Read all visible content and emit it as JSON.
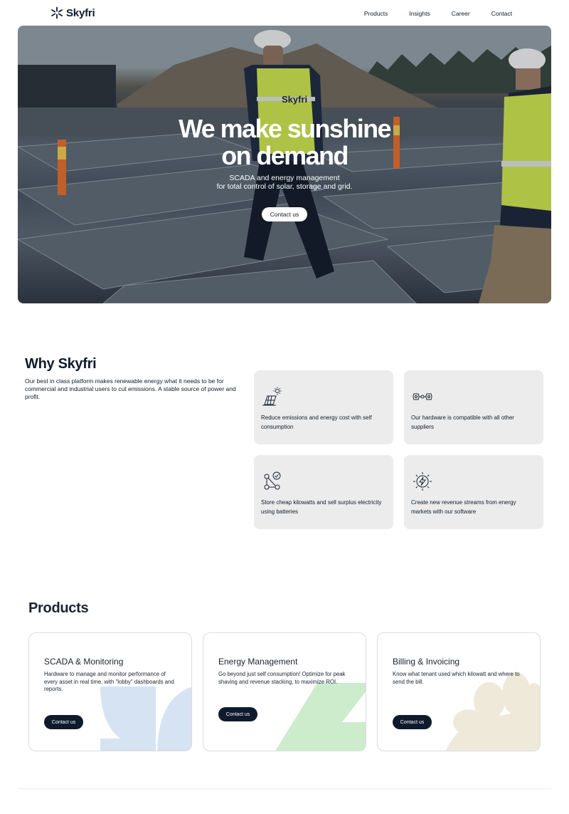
{
  "nav": {
    "brand": "Skyfri",
    "links": [
      "Products",
      "Insights",
      "Career",
      "Contact"
    ]
  },
  "hero": {
    "title_line1": "We make sunshine",
    "title_line2": "on demand",
    "subtitle_line1": "SCADA and energy management",
    "subtitle_line2": "for total control of solar, storage and grid.",
    "cta": "Contact us",
    "vest_logo": "Skyfri"
  },
  "why": {
    "title": "Why Skyfri",
    "description": "Our best in class platform makes renewable energy what it needs to be for commercial and industrial users to cut emissions. A stable source of power and profit.",
    "features": [
      {
        "icon": "solar-panel-icon",
        "text": "Reduce emissions and energy cost with self consumption"
      },
      {
        "icon": "hardware-link-icon",
        "text": "Our hardware is compatible with all other suppliers"
      },
      {
        "icon": "battery-network-icon",
        "text": "Store cheap kilowatts and sell surplus electricity using batteries"
      },
      {
        "icon": "lightning-sun-icon",
        "text": "Create new revenue streams from energy markets with our software"
      }
    ]
  },
  "products": {
    "title": "Products",
    "cards": [
      {
        "title": "SCADA & Monitoring",
        "description": "Hardware to manage and monitor performance of every asset in real time, with \"lobby\" dashboards and reports.",
        "cta": "Contact us"
      },
      {
        "title": "Energy Management",
        "description": "Go beyond just self consumption! Optimize for peak shaving and revenue stacking, to maximize ROI.",
        "cta": "Contact us"
      },
      {
        "title": "Billing & Invoicing",
        "description": "Know what tenant used which kilowatt and where to send the bill.",
        "cta": "Contact us"
      }
    ]
  },
  "colors": {
    "navy": "#0f1b2d",
    "card_gray": "#ececec",
    "deco_blue": "#d6e3f3",
    "deco_green": "#cdeccc",
    "deco_beige": "#efe9da",
    "vest_yellow": "#c9e04a"
  }
}
